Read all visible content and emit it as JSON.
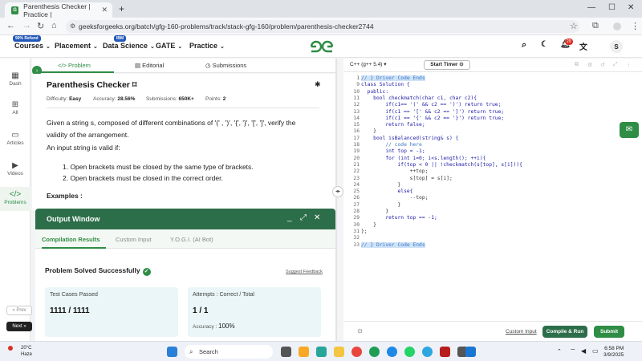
{
  "browser": {
    "tab_title": "Parenthesis Checker | Practice |",
    "url": "geeksforgeeks.org/batch/gfg-160-problems/track/stack-gfg-160/problem/parenthesis-checker2744"
  },
  "header": {
    "nav": [
      {
        "label": "Courses",
        "badge": "90% Refund"
      },
      {
        "label": "Placement",
        "badge": ""
      },
      {
        "label": "Data Science",
        "badge": "IBM"
      },
      {
        "label": "GATE",
        "badge": ""
      },
      {
        "label": "Practice",
        "badge": ""
      }
    ],
    "notif_count": "29",
    "avatar_letter": "S"
  },
  "sidebar": {
    "items": [
      "Dash",
      "All",
      "Articles",
      "Videos",
      "Problems"
    ],
    "prev": "« Prev",
    "next": "Next »"
  },
  "problem": {
    "tabs": [
      "Problem",
      "Editorial",
      "Submissions"
    ],
    "title": "Parenthesis Checker",
    "difficulty_label": "Difficulty:",
    "difficulty": "Easy",
    "accuracy_label": "Accuracy:",
    "accuracy": "28.56%",
    "submissions_label": "Submissions:",
    "submissions": "650K+",
    "points_label": "Points:",
    "points": "2",
    "desc_1": "Given a string s, composed of different combinations of '(' , ')', '{', '}', '[', ']', verify the",
    "desc_2": "validity of the arrangement.",
    "desc_3": "An input string is valid if:",
    "rule_1": "1. Open brackets must be closed by the same type of brackets.",
    "rule_2": "2. Open brackets must be closed in the correct order.",
    "examples": "Examples :"
  },
  "output": {
    "title": "Output Window",
    "tabs": [
      "Compilation Results",
      "Custom Input",
      "Y.O.G.I. (AI Bot)"
    ],
    "status": "Problem Solved Successfully",
    "feedback": "Suggest Feedback",
    "tests_label": "Test Cases Passed",
    "tests_value": "1111 / 1111",
    "attempts_label": "Attempts : Correct / Total",
    "attempts_value": "1 / 1",
    "accuracy_label": "Accuracy :",
    "accuracy_value": "100%"
  },
  "editor": {
    "language": "C++ (g++ 5.4)",
    "timer": "Start Timer",
    "custom_input": "Custom Input",
    "compile": "Compile & Run",
    "submit": "Submit",
    "lines": [
      {
        "n": "1",
        "t": "// } Driver Code Ends"
      },
      {
        "n": "9",
        "t": "class Solution {"
      },
      {
        "n": "10",
        "t": "  public:"
      },
      {
        "n": "11",
        "t": "    bool checkmatch(char c1, char c2){"
      },
      {
        "n": "12",
        "t": "        if(c1== '(' && c2 == ')') return true;"
      },
      {
        "n": "13",
        "t": "        if(c1 == '[' && c2 == ']') return true;"
      },
      {
        "n": "14",
        "t": "        if(c1 == '{' && c2 == '}') return true;"
      },
      {
        "n": "15",
        "t": "        return false;"
      },
      {
        "n": "16",
        "t": "    }"
      },
      {
        "n": "17",
        "t": "    bool isBalanced(string& s) {"
      },
      {
        "n": "18",
        "t": "        // code here"
      },
      {
        "n": "19",
        "t": "        int top = -1;"
      },
      {
        "n": "20",
        "t": "        for (int i=0; i<s.length(); ++i){"
      },
      {
        "n": "21",
        "t": "            if(top < 0 || !checkmatch(s[top], s[i])){"
      },
      {
        "n": "22",
        "t": "                ++top;"
      },
      {
        "n": "23",
        "t": "                s[top] = s[i];"
      },
      {
        "n": "24",
        "t": "            }"
      },
      {
        "n": "25",
        "t": "            else{"
      },
      {
        "n": "26",
        "t": "                --top;"
      },
      {
        "n": "27",
        "t": "            }"
      },
      {
        "n": "28",
        "t": "        }"
      },
      {
        "n": "29",
        "t": "        return top == -1;"
      },
      {
        "n": "30",
        "t": "    }"
      },
      {
        "n": "31",
        "t": "};"
      },
      {
        "n": "32",
        "t": ""
      },
      {
        "n": "33",
        "t": "// } Driver Code Ends"
      }
    ]
  },
  "taskbar": {
    "temp": "20°C",
    "weather": "Haze",
    "search": "Search",
    "time": "6:58 PM",
    "date": "3/9/2025"
  },
  "colors": {
    "gfg_green": "#2f8d46",
    "output_header": "#2c6e49",
    "card_bg": "#eaf6f7"
  }
}
